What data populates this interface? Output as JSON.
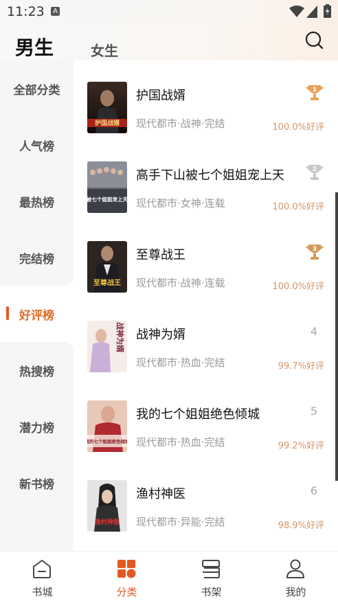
{
  "status_bar": {
    "time": "11:23",
    "notif_icon": "A"
  },
  "header": {
    "tab_male": "男生",
    "tab_female": "女生"
  },
  "sidebar": {
    "items": [
      {
        "label": "全部分类"
      },
      {
        "label": "人气榜"
      },
      {
        "label": "最热榜"
      },
      {
        "label": "完结榜"
      },
      {
        "label": "好评榜",
        "active": true
      },
      {
        "label": "热搜榜"
      },
      {
        "label": "潜力榜"
      },
      {
        "label": "新书榜"
      }
    ]
  },
  "books": [
    {
      "title": "护国战婿",
      "meta": "现代都市·战神·完结",
      "rating": "100.0%好评",
      "rank": "1",
      "cover_text": "护国战婿"
    },
    {
      "title": "高手下山被七个姐姐宠上天",
      "meta": "现代都市·女神·连载",
      "rating": "100.0%好评",
      "rank": "2",
      "cover_text": "被七个姐姐宠上天"
    },
    {
      "title": "至尊战王",
      "meta": "现代都市·战神·连载",
      "rating": "100.0%好评",
      "rank": "3",
      "cover_text": "至尊战王"
    },
    {
      "title": "战神为婿",
      "meta": "现代都市·热血·完结",
      "rating": "99.7%好评",
      "rank": "4",
      "cover_text": "战神为婿"
    },
    {
      "title": "我的七个姐姐绝色倾城",
      "meta": "现代都市·热血·完结",
      "rating": "99.2%好评",
      "rank": "5",
      "cover_text": "我的七个姐姐绝色倾城"
    },
    {
      "title": "渔村神医",
      "meta": "现代都市·异能·完结",
      "rating": "98.9%好评",
      "rank": "6",
      "cover_text": "渔村神医"
    }
  ],
  "bottom_nav": {
    "items": [
      {
        "label": "书城",
        "icon": "home-icon"
      },
      {
        "label": "分类",
        "icon": "category-icon",
        "active": true
      },
      {
        "label": "书架",
        "icon": "bookshelf-icon"
      },
      {
        "label": "我的",
        "icon": "profile-icon"
      }
    ]
  },
  "colors": {
    "accent": "#e05a22",
    "rating": "#d4956a",
    "gold": "#e8a25a",
    "silver": "#c8c8c8",
    "bronze": "#d49a5e"
  }
}
